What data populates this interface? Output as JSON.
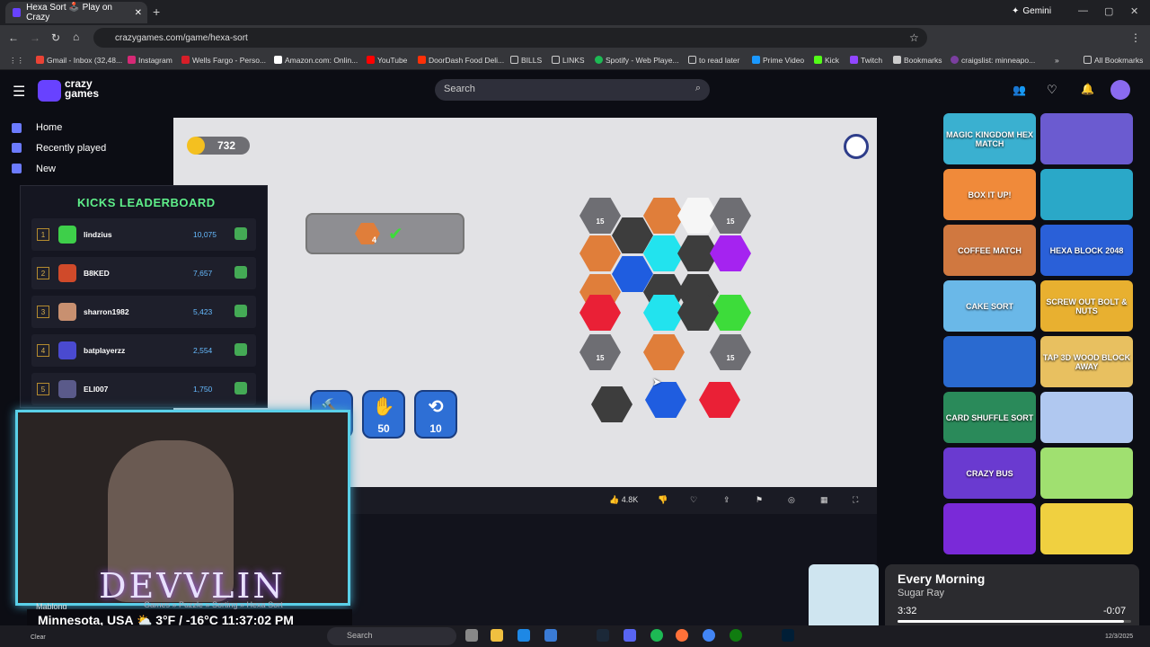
{
  "browser": {
    "tab_title": "Hexa Sort 🕹️ Play on Crazy",
    "gemini": "Gemini",
    "url": "crazygames.com/game/hexa-sort",
    "bookmarks": [
      "Gmail - Inbox (32,48...",
      "Instagram",
      "Wells Fargo - Perso...",
      "Amazon.com: Onlin...",
      "YouTube",
      "DoorDash Food Deli...",
      "BILLS",
      "LINKS",
      "Spotify - Web Playe...",
      "to read later",
      "Prime Video",
      "Kick",
      "Twitch",
      "Bookmarks",
      "craigslist: minneapo..."
    ],
    "all_bookmarks": "All Bookmarks"
  },
  "site": {
    "logo_line1": "crazy",
    "logo_line2": "games",
    "search_placeholder": "Search",
    "nav": [
      "Home",
      "Recently played",
      "New"
    ]
  },
  "game": {
    "coins": "732",
    "goal_count": "4",
    "board_hex_value": "15",
    "powerups": [
      {
        "name": "hammer",
        "cost": ""
      },
      {
        "name": "hand",
        "cost": "50"
      },
      {
        "name": "shuffle",
        "cost": "10"
      }
    ],
    "colors": {
      "orange": "#e07e3a",
      "gray": "#3d3d3d",
      "cyan": "#22e3ee",
      "blue": "#1f5de0",
      "purple": "#a523f0",
      "red": "#ea2036",
      "green": "#3ddc3a",
      "white": "#f6f6f6",
      "locked": "#6e6e73"
    }
  },
  "gamebar": {
    "likes": "4.8K"
  },
  "leaderboard": {
    "title": "KICKS LEADERBOARD",
    "rows": [
      {
        "rank": "1",
        "name": "lindzius",
        "score": "10,075"
      },
      {
        "rank": "2",
        "name": "B8KED",
        "score": "7,657"
      },
      {
        "rank": "3",
        "name": "sharron1982",
        "score": "5,423"
      },
      {
        "rank": "4",
        "name": "batplayerzz",
        "score": "2,554"
      },
      {
        "rank": "5",
        "name": "ELI007",
        "score": "1,750"
      }
    ]
  },
  "overlay": {
    "name": "DEVVLIN",
    "location": "Minnesota, USA",
    "weather": "3°F / -16°C",
    "time": "11:37:02 PM",
    "mablong": "Mablong",
    "breadcrumbs": "Games » Puzzle » Sorting » Hexa Sort"
  },
  "thumbnails": [
    "MAGIC KINGDOM HEX MATCH",
    "",
    "BOX IT UP!",
    "",
    "COFFEE MATCH",
    "HEXA BLOCK 2048",
    "CAKE SORT",
    "SCREW OUT BOLT & NUTS",
    "",
    "TAP 3D WOOD BLOCK AWAY",
    "CARD SHUFFLE SORT",
    "",
    "CRAZY BUS",
    "",
    "",
    ""
  ],
  "media": {
    "title": "Every Morning",
    "artist": "Sugar Ray",
    "elapsed": "3:32",
    "remaining": "-0:07",
    "progress": 0.97
  },
  "taskbar": {
    "search": "Search",
    "weather": "Clear",
    "date": "12/3/2025"
  }
}
